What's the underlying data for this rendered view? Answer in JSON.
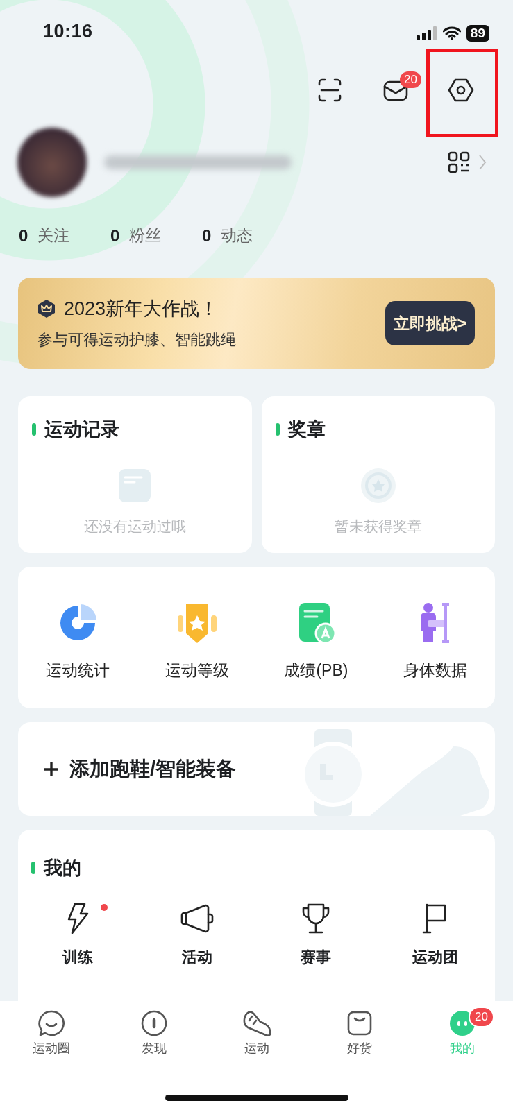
{
  "status_bar": {
    "time": "10:16",
    "battery": "89"
  },
  "header": {
    "message_badge": "20",
    "settings_highlighted": true
  },
  "profile": {
    "stats": [
      {
        "count": "0",
        "label": "关注"
      },
      {
        "count": "0",
        "label": "粉丝"
      },
      {
        "count": "0",
        "label": "动态"
      }
    ]
  },
  "banner": {
    "title": "2023新年大作战！",
    "subtitle": "参与可得运动护膝、智能跳绳",
    "button": "立即挑战>"
  },
  "summary_cards": [
    {
      "kind": "record",
      "title": "运动记录",
      "empty_text": "还没有运动过哦"
    },
    {
      "kind": "medal",
      "title": "奖章",
      "empty_text": "暂未获得奖章"
    }
  ],
  "features": [
    {
      "kind": "stats",
      "label": "运动统计"
    },
    {
      "kind": "level",
      "label": "运动等级"
    },
    {
      "kind": "pb",
      "label": "成绩(PB)"
    },
    {
      "kind": "body",
      "label": "身体数据"
    }
  ],
  "device_card": {
    "label": "添加跑鞋/智能装备"
  },
  "mine": {
    "title": "我的",
    "items": [
      {
        "kind": "training",
        "label": "训练",
        "dot": true
      },
      {
        "kind": "activity",
        "label": "活动",
        "dot": false
      },
      {
        "kind": "match",
        "label": "赛事",
        "dot": false
      },
      {
        "kind": "team",
        "label": "运动团",
        "dot": false
      }
    ]
  },
  "tab_bar": [
    {
      "kind": "circle",
      "label": "运动圈",
      "selected": false
    },
    {
      "kind": "discover",
      "label": "发现",
      "selected": false
    },
    {
      "kind": "sport",
      "label": "运动",
      "selected": false
    },
    {
      "kind": "shop",
      "label": "好货",
      "selected": false
    },
    {
      "kind": "me",
      "label": "我的",
      "selected": true,
      "badge": "20"
    }
  ]
}
